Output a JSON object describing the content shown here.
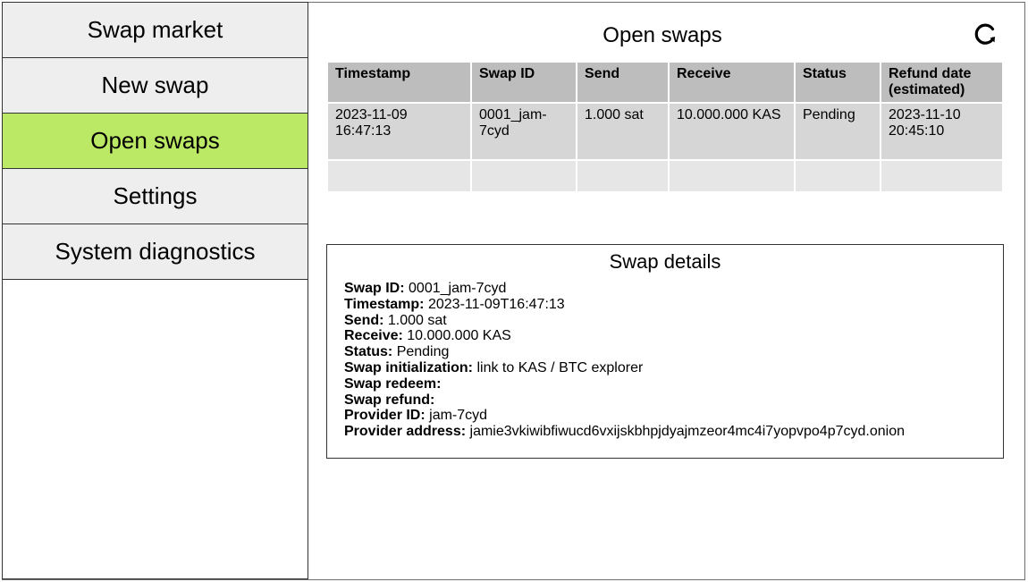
{
  "sidebar": {
    "items": [
      {
        "label": "Swap market",
        "active": false
      },
      {
        "label": "New swap",
        "active": false
      },
      {
        "label": "Open swaps",
        "active": true
      },
      {
        "label": "Settings",
        "active": false
      },
      {
        "label": "System diagnostics",
        "active": false
      }
    ]
  },
  "colors": {
    "active_nav": "#bbe865",
    "nav_bg": "#eeeeee",
    "table_header": "#bdbdbd",
    "table_row": "#d6d6d6"
  },
  "main": {
    "title": "Open swaps",
    "refresh_icon": "refresh-icon",
    "table": {
      "headers": [
        "Timestamp",
        "Swap ID",
        "Send",
        "Receive",
        "Status",
        "Refund date (estimated)"
      ],
      "rows": [
        [
          "2023-11-09 16:47:13",
          "0001_jam-7cyd",
          "1.000 sat",
          "10.000.000 KAS",
          "Pending",
          "2023-11-10 20:45:10"
        ]
      ]
    },
    "details": {
      "title": "Swap details",
      "fields": [
        {
          "label": "Swap ID:",
          "value": "0001_jam-7cyd"
        },
        {
          "label": "Timestamp:",
          "value": "2023-11-09T16:47:13"
        },
        {
          "label": "Send:",
          "value": "1.000 sat"
        },
        {
          "label": "Receive:",
          "value": "10.000.000 KAS"
        },
        {
          "label": "Status:",
          "value": "Pending"
        },
        {
          "label": "Swap initialization:",
          "value": "link to KAS / BTC explorer"
        },
        {
          "label": "Swap redeem:",
          "value": ""
        },
        {
          "label": "Swap refund:",
          "value": ""
        },
        {
          "label": "Provider ID:",
          "value": "jam-7cyd"
        },
        {
          "label": "Provider address:",
          "value": "jamie3vkiwibfiwucd6vxijskbhpjdyajmzeor4mc4i7yopvpo4p7cyd.onion"
        }
      ]
    }
  }
}
